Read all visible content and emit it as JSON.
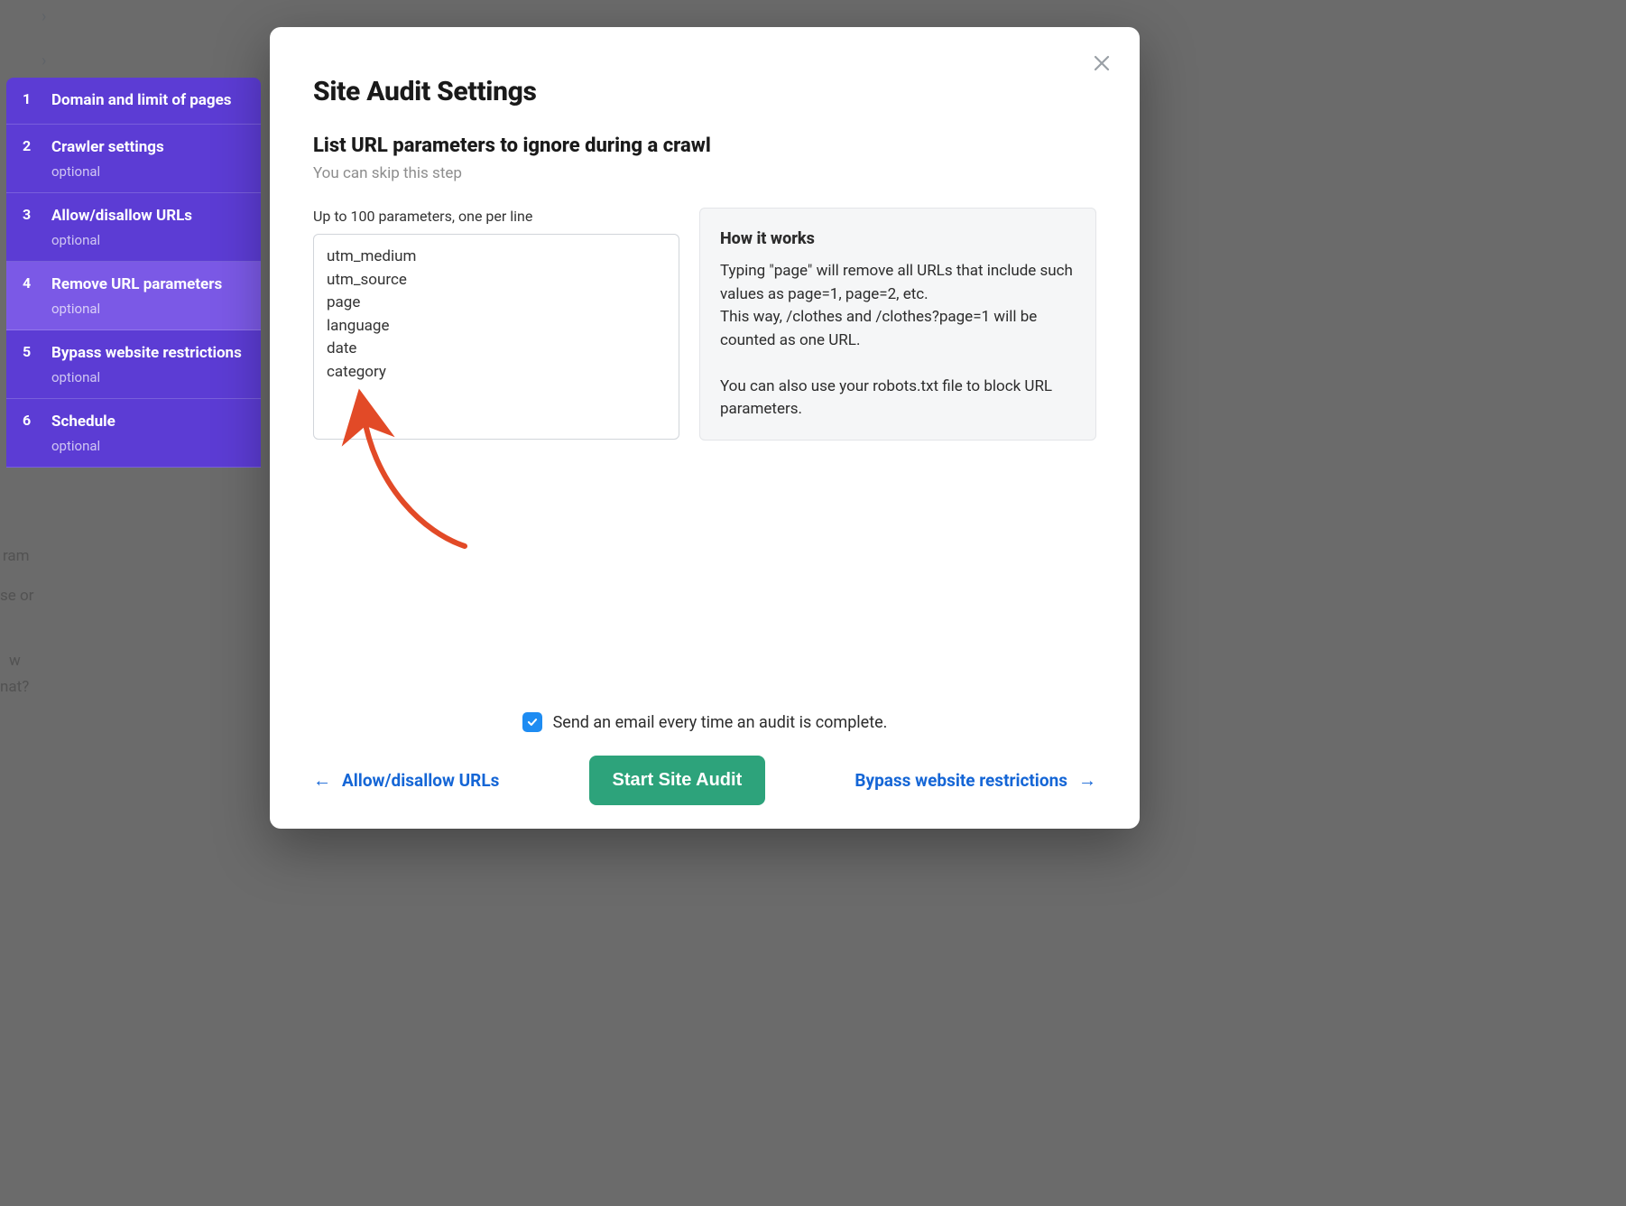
{
  "backgroundFragments": {
    "a": "ram",
    "b": "se or",
    "c": "w",
    "d": "nat?"
  },
  "sidebar": {
    "items": [
      {
        "num": "1",
        "title": "Domain and limit of pages",
        "optional": ""
      },
      {
        "num": "2",
        "title": "Crawler settings",
        "optional": "optional"
      },
      {
        "num": "3",
        "title": "Allow/disallow URLs",
        "optional": "optional"
      },
      {
        "num": "4",
        "title": "Remove URL parameters",
        "optional": "optional"
      },
      {
        "num": "5",
        "title": "Bypass website restrictions",
        "optional": "optional"
      },
      {
        "num": "6",
        "title": "Schedule",
        "optional": "optional"
      }
    ],
    "activeIndex": 3
  },
  "modal": {
    "title": "Site Audit Settings",
    "subtitle": "List URL parameters to ignore during a crawl",
    "hint": "You can skip this step",
    "fieldLabel": "Up to 100 parameters, one per line",
    "textareaValue": "utm_medium\nutm_source\npage\nlanguage\ndate\ncategory",
    "help": {
      "title": "How it works",
      "para1": "Typing \"page\" will remove all URLs that include such values as page=1, page=2, etc.",
      "para2": "This way, /clothes and /clothes?page=1 will be counted as one URL.",
      "para3": "You can also use your robots.txt file to block URL parameters."
    },
    "checkboxLabel": "Send an email every time an audit is complete.",
    "checkboxChecked": true,
    "backLabel": "Allow/disallow URLs",
    "nextLabel": "Bypass website restrictions",
    "primaryCta": "Start Site Audit"
  },
  "colors": {
    "sidebar": "#5c3cd4",
    "sidebarActive": "#7b59e6",
    "primaryBtn": "#2da37b",
    "link": "#1566d6",
    "annotation": "#e24a27"
  }
}
